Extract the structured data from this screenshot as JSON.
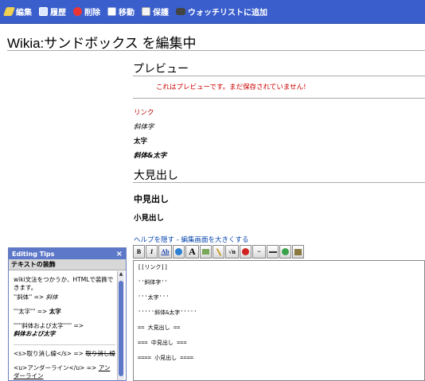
{
  "topbar": {
    "items": [
      {
        "label": "編集",
        "icon": "pencil-icon"
      },
      {
        "label": "履歴",
        "icon": "history-icon"
      },
      {
        "label": "削除",
        "icon": "delete-icon"
      },
      {
        "label": "移動",
        "icon": "move-icon"
      },
      {
        "label": "保護",
        "icon": "protect-icon"
      },
      {
        "label": "ウォッチリストに追加",
        "icon": "watchlist-icon"
      }
    ]
  },
  "page": {
    "title": "Wikia:サンドボックス を編集中"
  },
  "preview": {
    "heading": "プレビュー",
    "warning": "これはプレビューです。まだ保存されていません!",
    "link": "リンク",
    "italic": "斜体字",
    "bold": "太字",
    "bolditalic": "斜体&太字",
    "h_large": "大見出し",
    "h_medium": "中見出し",
    "h_small": "小見出し"
  },
  "help": {
    "hide": "ヘルプを隠す",
    "sep": " - ",
    "enlarge": "編集画面を大きくする"
  },
  "toolbar": {
    "buttons": [
      "B",
      "I",
      "Ab",
      "",
      "A",
      "",
      "",
      "√n",
      "W",
      "",
      "—",
      "",
      ""
    ]
  },
  "editor": {
    "lines": [
      "[[リンク]]",
      "''斜体字''",
      "'''太字'''",
      "'''''斜体&太字'''''",
      "== 大見出し ==",
      "=== 中見出し ===",
      "==== 小見出し ===="
    ]
  },
  "tips": {
    "title": "Editing Tips",
    "close": "×",
    "section": "テキストの装飾",
    "p1": "wiki文法をつかうか、HTMLで装飾できます。",
    "p1b": "''斜体'' => ",
    "p1b_res": "斜体",
    "p2": "'''太字''' => ",
    "p2_res": "太字",
    "p3": "'''''斜体および太字''''' =>",
    "p3_res": "斜体および太字",
    "p4": "<s>取り消し線</s> => ",
    "p4_res": "取り消し線",
    "p5": "<u>アンダーライン</u> => ",
    "p5_res": "アンダーライン"
  }
}
